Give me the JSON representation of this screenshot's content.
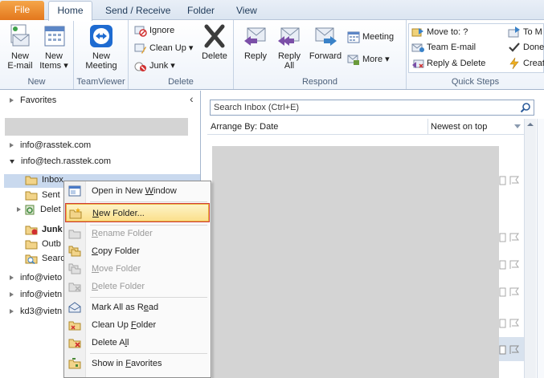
{
  "tabs": {
    "file": "File",
    "home": "Home",
    "send_receive": "Send / Receive",
    "folder": "Folder",
    "view": "View"
  },
  "ribbon": {
    "groups": {
      "new": "New",
      "teamviewer": "TeamViewer",
      "delete": "Delete",
      "respond": "Respond",
      "quick_steps": "Quick Steps"
    },
    "new_email": [
      "New",
      "E-mail"
    ],
    "new_items": [
      "New",
      "Items ▾"
    ],
    "new_meeting": [
      "New",
      "Meeting"
    ],
    "ignore": "Ignore",
    "clean_up": "Clean Up ▾",
    "junk": "Junk ▾",
    "delete": "Delete",
    "reply": "Reply",
    "reply_all": [
      "Reply",
      "All"
    ],
    "forward": "Forward",
    "meeting": "Meeting",
    "more": "More ▾",
    "quick_steps": {
      "move_to": "Move to: ?",
      "team_email": "Team E-mail",
      "reply_delete": "Reply & Delete",
      "to_manager": "To M",
      "done": "Done",
      "create_new": "Creat"
    }
  },
  "nav": {
    "favorites": "Favorites",
    "accounts": [
      "info@rasstek.com",
      "info@tech.rasstek.com",
      "info@vieto",
      "info@vietn",
      "kd3@vietn"
    ],
    "folders": {
      "inbox": "Inbox",
      "sent": "Sent",
      "deleted": "Delet",
      "junk": "Junk",
      "outbox": "Outb",
      "search": "Searc"
    }
  },
  "list": {
    "search_placeholder": "Search Inbox (Ctrl+E)",
    "arrange_by": "Arrange By: Date",
    "sort": "Newest on top"
  },
  "context_menu": {
    "open_new_window": [
      "Open in New ",
      "W",
      "indow"
    ],
    "new_folder": [
      "",
      "N",
      "ew Folder..."
    ],
    "rename_folder": [
      "",
      "R",
      "ename Folder"
    ],
    "copy_folder": [
      "",
      "C",
      "opy Folder"
    ],
    "move_folder": [
      "",
      "M",
      "ove Folder"
    ],
    "delete_folder": [
      "",
      "D",
      "elete Folder"
    ],
    "mark_all_read": [
      "Mark All as R",
      "e",
      "ad"
    ],
    "clean_up_folder": [
      "Clean Up ",
      "F",
      "older"
    ],
    "delete_all": [
      "Delete A",
      "l",
      "l"
    ],
    "show_in_favorites": [
      "Show in ",
      "F",
      "avorites"
    ]
  },
  "colors": {
    "file_tab": "#e3771d",
    "selection": "#c9d9ee",
    "menu_highlight": "#fbe08c",
    "highlight_outline": "#d13a3a"
  }
}
